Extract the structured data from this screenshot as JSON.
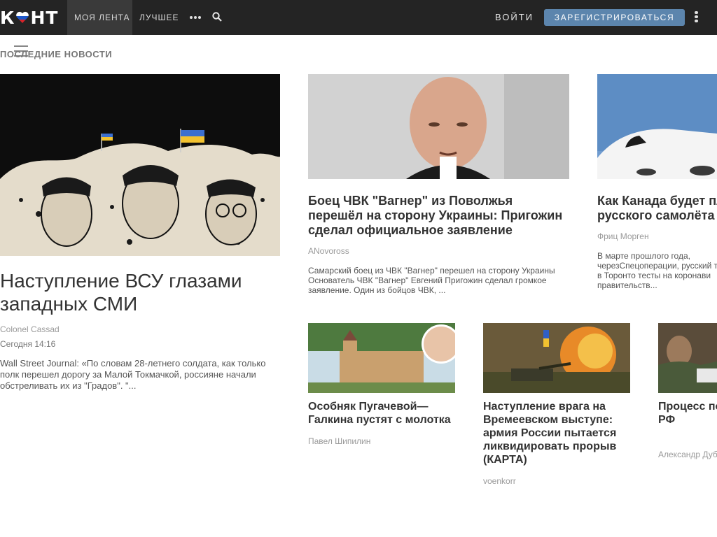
{
  "header": {
    "logo_left": "К",
    "logo_right": "НТ",
    "nav": {
      "my_feed": "МОЯ ЛЕНТА",
      "best": "ЛУЧШЕЕ"
    },
    "login": "ВОЙТИ",
    "register": "ЗАРЕГИСТРИРОВАТЬСЯ"
  },
  "section_title": "ПОСЛЕДНИЕ НОВОСТИ",
  "colors": {
    "topbar": "#242424",
    "accent": "#5c85ad"
  },
  "featured": {
    "title": "Наступление ВСУ глазами западных СМИ",
    "author": "Colonel Cassad",
    "date": "Сегодня 14:16",
    "excerpt": "Wall Street Journal: «По словам 28-летнего солдата, как только полк перешел дорогу за Малой Токмачкой, россияне начали обстреливать их из \"Градов\". \"..."
  },
  "articles": [
    {
      "title": "Боец ЧВК \"Вагнер\" из Поволжья перешёл на сторону Украины: Пригожин сделал официальное заявление",
      "author": "ANovoross",
      "excerpt": "Самарский боец из ЧВК \"Вагнер\" перешел на сторону Украины Основатель ЧВК \"Вагнер\" Евгений Пригожин сделал громкое заявление. Один из бойцов ЧВК, ..."
    },
    {
      "title": "Как Канада будет пл русского самолёта",
      "author": "Фриц Морген",
      "excerpt": "В марте прошлого года, черезСпецоперации, русский транс в Торонто тесты на коронави правительств..."
    },
    {
      "title": "Особняк Пугачевой— Галкина пустят с молотка",
      "author": "Павел Шипилин"
    },
    {
      "title": "Наступление врага на Времеевском выступе: армия России пытается ликвидировать прорыв (КАРТА)",
      "author": "voenkorr"
    },
    {
      "title": "Процесс по подписал к РФ",
      "author": "Александр Дуб"
    }
  ]
}
